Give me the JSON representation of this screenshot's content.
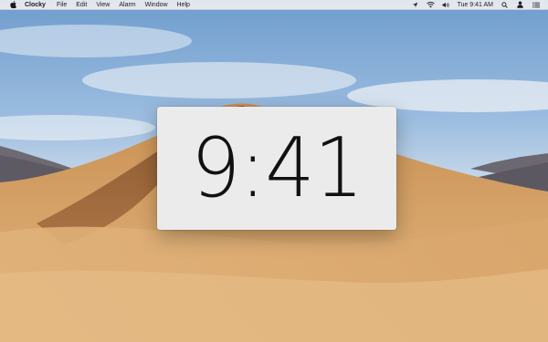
{
  "menubar": {
    "app_name": "Clocky",
    "items": [
      "File",
      "Edit",
      "View",
      "Alarm",
      "Window",
      "Help"
    ],
    "status": {
      "time_text": "Tue 9:41 AM",
      "icons": [
        "location-icon",
        "wifi-icon",
        "volume-icon",
        "search-icon",
        "user-icon",
        "list-icon"
      ]
    }
  },
  "clock": {
    "time": "9:41"
  },
  "colors": {
    "window_bg": "#ebebeb",
    "menubar_bg": "#eceef1",
    "clock_text": "#111111"
  }
}
